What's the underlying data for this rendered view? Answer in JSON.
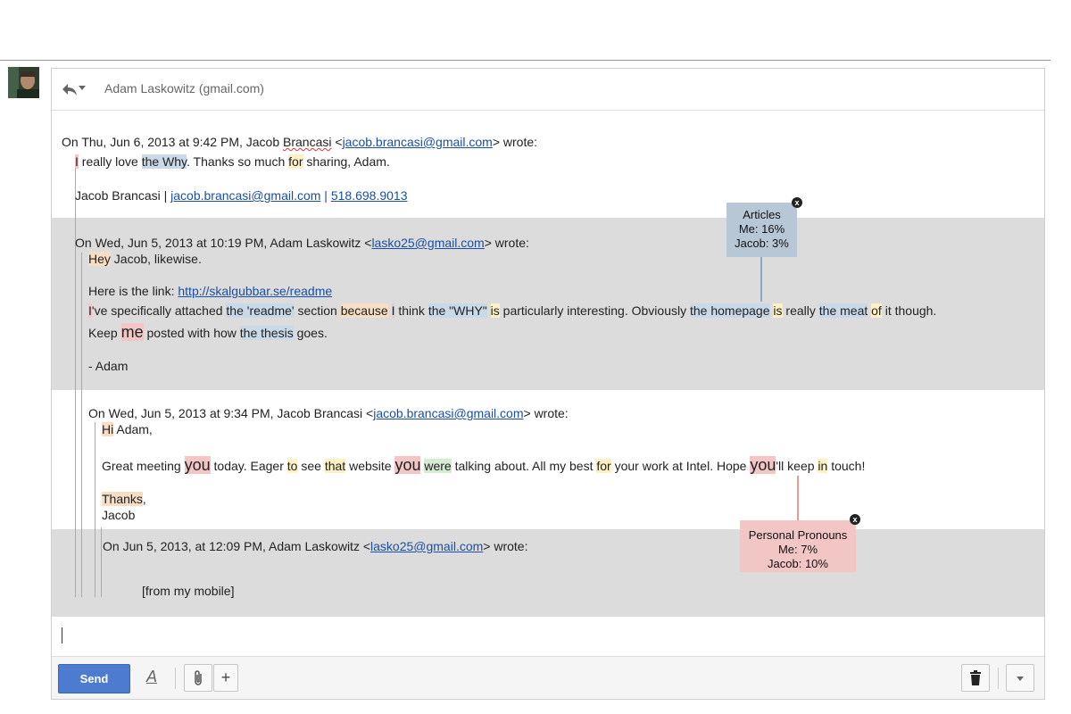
{
  "thread": {
    "sender": "Adam Laskowitz (gmail.com)"
  },
  "msg1": {
    "header_pre": "On Thu, Jun 6, 2013 at 9:42 PM, Jacob ",
    "header_name2": "Brancasi",
    "header_lt": " <",
    "header_email": "jacob.brancasi@gmail.com",
    "header_post": "> wrote:",
    "line1": {
      "w1": "I",
      "s1": " really love ",
      "w2": "the Why",
      "s2": ". Thanks so much ",
      "w3": "for",
      "s3": " sharing, Adam."
    },
    "sig_name": "Jacob Brancasi | ",
    "sig_email": "jacob.brancasi@gmail.com",
    "sig_sep": " | ",
    "sig_phone": "518.698.9013"
  },
  "msg2": {
    "header_pre": "On Wed, Jun 5, 2013 at 10:19 PM, Adam Laskowitz <",
    "header_email": "lasko25@gmail.com",
    "header_post": "> wrote:",
    "greet_w": "Hey",
    "greet_rest": " Jacob, likewise.",
    "link_pre": "Here is the link: ",
    "link_url": "http://skalgubbar.se/readme",
    "body": {
      "p1": "I",
      "p2": "'ve specifically attached ",
      "p3": "the 'readme'",
      "p4": " section ",
      "p5": "because",
      "p6": " ",
      "p7": "I",
      "p8": " think ",
      "p9": "the \"WHY\"",
      "p10": " ",
      "p11": "is",
      "p12": " particularly interesting.  Obviously ",
      "p13": "the homepage",
      "p14": " ",
      "p15": "is",
      "p16": " really ",
      "p17": "the meat",
      "p18": " ",
      "p19": "of",
      "p20": " it though."
    },
    "keep1": "Keep ",
    "keep_me": "me",
    "keep2": " posted with how ",
    "keep_thesis": "the thesis",
    "keep3": " goes.",
    "sign": "- Adam"
  },
  "msg3": {
    "header_pre": "On Wed, Jun 5, 2013 at 9:34 PM, Jacob Brancasi <",
    "header_email": "jacob.brancasi@gmail.com",
    "header_post": "> wrote:",
    "greet_w": "Hi",
    "greet_rest": " Adam,",
    "body": {
      "a1": "Great meeting ",
      "you1": "you",
      "a2": " today. Eager ",
      "to": "to",
      "a3": " see ",
      "that": "that",
      "a4": " website ",
      "you2": "you",
      "a5": " ",
      "were": "were",
      "a6": " talking about. All my best ",
      "for": "for",
      "a7": " your work at Intel. Hope ",
      "you3": "you",
      "a8": "'ll keep ",
      "in": "in",
      "a9": " touch!"
    },
    "thanks": "Thanks",
    "thanks_comma": ",",
    "sign": "Jacob"
  },
  "msg4": {
    "header_pre": "On Jun 5, 2013, at 12:09 PM, Adam Laskowitz <",
    "header_email": "lasko25@gmail.com",
    "header_post": "> wrote:",
    "body": "[from my mobile]"
  },
  "tooltips": {
    "articles": {
      "title": "Articles",
      "me": "Me: 16%",
      "jacob": "Jacob: 3%",
      "close": "x",
      "color": "#b7c7d6"
    },
    "pronouns": {
      "title": "Personal Pronouns",
      "me": "Me: 7%",
      "jacob": "Jacob: 10%",
      "close": "x",
      "color": "#f3c6c6"
    }
  },
  "toolbar": {
    "send_label": "Send",
    "format_label": "A",
    "attach_icon": "paperclip-icon",
    "plus_label": "+",
    "trash_icon": "trash-icon",
    "more_icon": "chevron-down-icon"
  },
  "colors": {
    "highlight_function": "#fbf0c6",
    "highlight_greeting": "#f6ddc3",
    "highlight_article": "#c9d9e8",
    "highlight_pronoun": "#f3c6c6",
    "highlight_other": "#d6ecd2",
    "send_button": "#4d7bd0",
    "quote_band": "#dcdcdc"
  }
}
